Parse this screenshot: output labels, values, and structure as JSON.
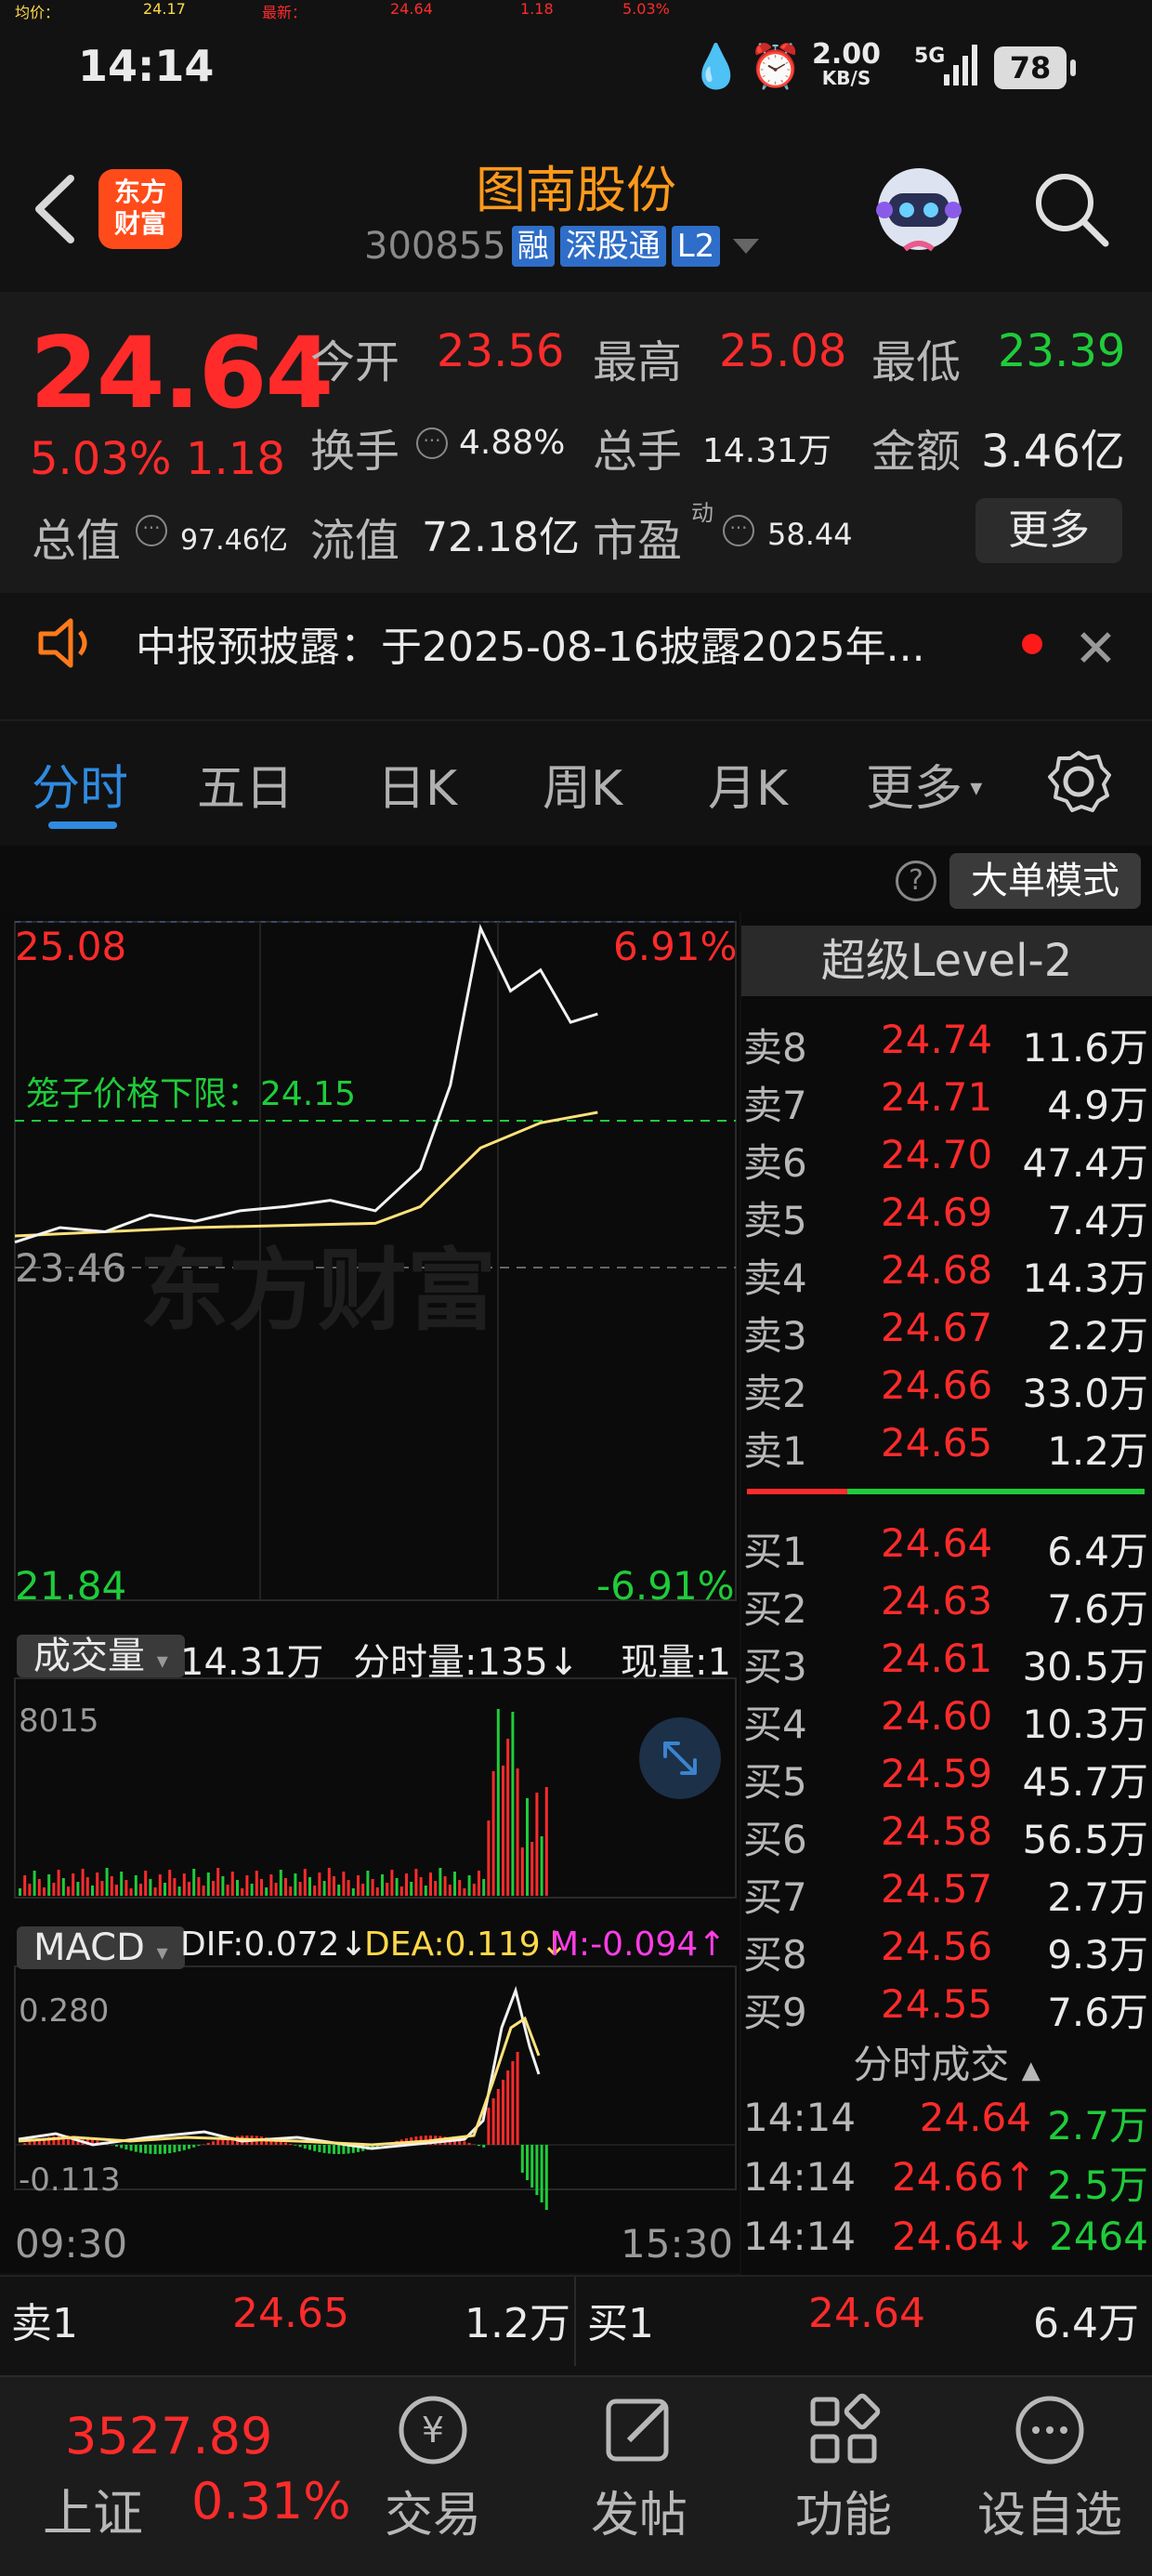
{
  "status": {
    "time": "14:14",
    "net_speed": "2.00",
    "net_unit": "KB/S",
    "network": "5G",
    "battery": "78"
  },
  "header": {
    "logo_line1": "东方",
    "logo_line2": "财富",
    "name": "图南股份",
    "code": "300855",
    "tags": [
      "融",
      "深股通",
      "L2"
    ]
  },
  "quote": {
    "last": "24.64",
    "pct": "5.03%",
    "chg": "1.18",
    "open_label": "今开",
    "open": "23.56",
    "high_label": "最高",
    "high": "25.08",
    "low_label": "最低",
    "low": "23.39",
    "turnover_label": "换手",
    "turnover": "4.88%",
    "volume_label": "总手",
    "volume": "14.31万",
    "amount_label": "金额",
    "amount": "3.46亿",
    "mcap_label": "总值",
    "mcap": "97.46亿",
    "float_label": "流值",
    "float_cap": "72.18亿",
    "pe_label": "市盈",
    "pe_sup": "动",
    "pe": "58.44",
    "more": "更多"
  },
  "notice": {
    "text": "中报预披露：于2025-08-16披露2025年..."
  },
  "tabs": [
    "分时",
    "五日",
    "日K",
    "周K",
    "月K",
    "更多"
  ],
  "avg_row": {
    "avg_label": "均价：",
    "avg": "24.17",
    "latest_label": "最新：",
    "latest": "24.64",
    "chg": "1.18",
    "pct": "5.03%",
    "big_order_btn": "大单模式"
  },
  "chart": {
    "top_price": "25.08",
    "top_pct": "6.91%",
    "mid_price": "23.46",
    "bottom_price": "21.84",
    "bottom_pct": "-6.91%",
    "cage_label": "笼子价格下限：24.15",
    "watermark": "东方财富",
    "vol_selector": "成交量",
    "vol_total": "14.31万",
    "tick_vol": "分时量:135↓",
    "now_vol": "现量:1",
    "vol_max": "8015",
    "macd_selector": "MACD",
    "dif": "DIF:0.072↓",
    "dea": "DEA:0.119↓",
    "m": "M:-0.094↑",
    "macd_max": "0.280",
    "macd_min": "-0.113",
    "time_start": "09:30",
    "time_end": "15:30"
  },
  "chart_data": {
    "type": "line",
    "series": [
      {
        "x": [
          "09:30",
          "09:45",
          "10:00",
          "10:15",
          "10:30",
          "10:45",
          "11:00",
          "11:15",
          "11:30",
          "13:15",
          "13:25",
          "13:35",
          "13:45",
          "13:55",
          "14:05",
          "14:14"
        ],
        "values": [
          23.55,
          23.62,
          23.6,
          23.68,
          23.65,
          23.7,
          23.72,
          23.75,
          23.7,
          23.9,
          24.3,
          25.05,
          24.75,
          24.85,
          24.6,
          24.64
        ]
      },
      {
        "x": [
          "09:30",
          "10:30",
          "11:30",
          "13:15",
          "13:35",
          "13:55",
          "14:14"
        ],
        "values": [
          23.58,
          23.62,
          23.64,
          23.72,
          24.0,
          24.12,
          24.17
        ]
      }
    ],
    "ylim": [
      21.84,
      25.08
    ]
  },
  "level2": {
    "title": "超级Level-2",
    "asks": [
      {
        "label": "卖8",
        "price": "24.74",
        "vol": "11.6万"
      },
      {
        "label": "卖7",
        "price": "24.71",
        "vol": "4.9万"
      },
      {
        "label": "卖6",
        "price": "24.70",
        "vol": "47.4万"
      },
      {
        "label": "卖5",
        "price": "24.69",
        "vol": "7.4万"
      },
      {
        "label": "卖4",
        "price": "24.68",
        "vol": "14.3万"
      },
      {
        "label": "卖3",
        "price": "24.67",
        "vol": "2.2万"
      },
      {
        "label": "卖2",
        "price": "24.66",
        "vol": "33.0万"
      },
      {
        "label": "卖1",
        "price": "24.65",
        "vol": "1.2万"
      }
    ],
    "bids": [
      {
        "label": "买1",
        "price": "24.64",
        "vol": "6.4万"
      },
      {
        "label": "买2",
        "price": "24.63",
        "vol": "7.6万"
      },
      {
        "label": "买3",
        "price": "24.61",
        "vol": "30.5万"
      },
      {
        "label": "买4",
        "price": "24.60",
        "vol": "10.3万"
      },
      {
        "label": "买5",
        "price": "24.59",
        "vol": "45.7万"
      },
      {
        "label": "买6",
        "price": "24.58",
        "vol": "56.5万"
      },
      {
        "label": "买7",
        "price": "24.57",
        "vol": "2.7万"
      },
      {
        "label": "买8",
        "price": "24.56",
        "vol": "9.3万"
      },
      {
        "label": "买9",
        "price": "24.55",
        "vol": "7.6万"
      }
    ],
    "trades_title": "分时成交",
    "trades": [
      {
        "time": "14:14",
        "price": "24.64",
        "vol": "2.7万"
      },
      {
        "time": "14:14",
        "price": "24.66↑",
        "vol": "2.5万"
      },
      {
        "time": "14:14",
        "price": "24.64↓",
        "vol": "2464"
      }
    ]
  },
  "ba_row": {
    "ask_label": "卖1",
    "ask_price": "24.65",
    "ask_vol": "1.2万",
    "bid_label": "买1",
    "bid_price": "24.64",
    "bid_vol": "6.4万"
  },
  "bottom": {
    "index_value": "3527.89",
    "index_name": "上证",
    "index_pct": "0.31%",
    "nav": [
      "交易",
      "发帖",
      "功能",
      "设自选"
    ]
  }
}
